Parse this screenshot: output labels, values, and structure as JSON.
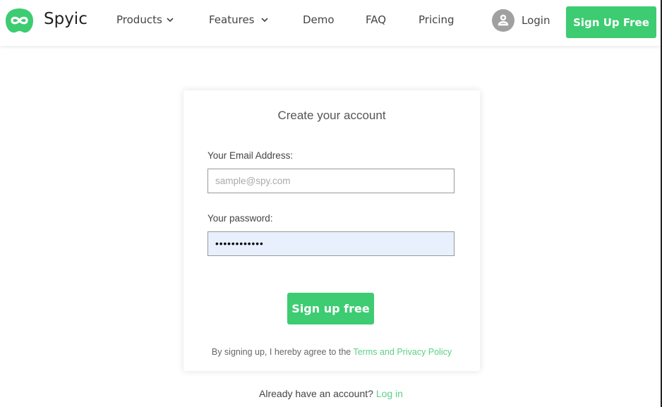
{
  "header": {
    "brand": "Spyic",
    "nav": [
      {
        "label": "Products",
        "has_dropdown": true
      },
      {
        "label": "Features",
        "has_dropdown": true
      },
      {
        "label": "Demo",
        "has_dropdown": false
      },
      {
        "label": "FAQ",
        "has_dropdown": false
      },
      {
        "label": "Pricing",
        "has_dropdown": false
      }
    ],
    "login_label": "Login",
    "signup_label": "Sign Up Free"
  },
  "form": {
    "title": "Create your account",
    "email_label": "Your Email Address:",
    "email_placeholder": "sample@spy.com",
    "email_value": "",
    "password_label": "Your password:",
    "password_value": "••••••••••••",
    "submit_label": "Sign up free",
    "terms_prefix": "By signing up, I hereby agree to the ",
    "terms_link": "Terms and Privacy Policy"
  },
  "footer": {
    "already_text": "Already have an account? ",
    "login_link": "Log in"
  },
  "colors": {
    "accent": "#3dcc71",
    "autofill_bg": "#e8f0fe"
  }
}
